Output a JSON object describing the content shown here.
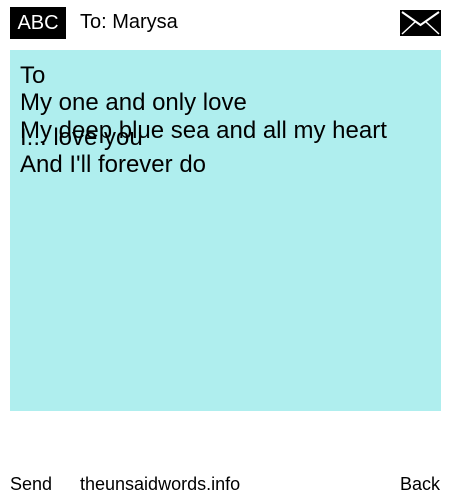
{
  "header": {
    "abc_label": "ABC",
    "to_text": "To: Marysa",
    "envelope_icon": "envelope-icon"
  },
  "message": {
    "background_color": "#afeeee",
    "lines": [
      "To",
      "My one and only love",
      "My deep blue sea and all my heart",
      "I... love you",
      "And I'll forever do"
    ]
  },
  "footer": {
    "send_label": "Send",
    "site_label": "theunsaidwords.info",
    "back_label": "Back"
  }
}
